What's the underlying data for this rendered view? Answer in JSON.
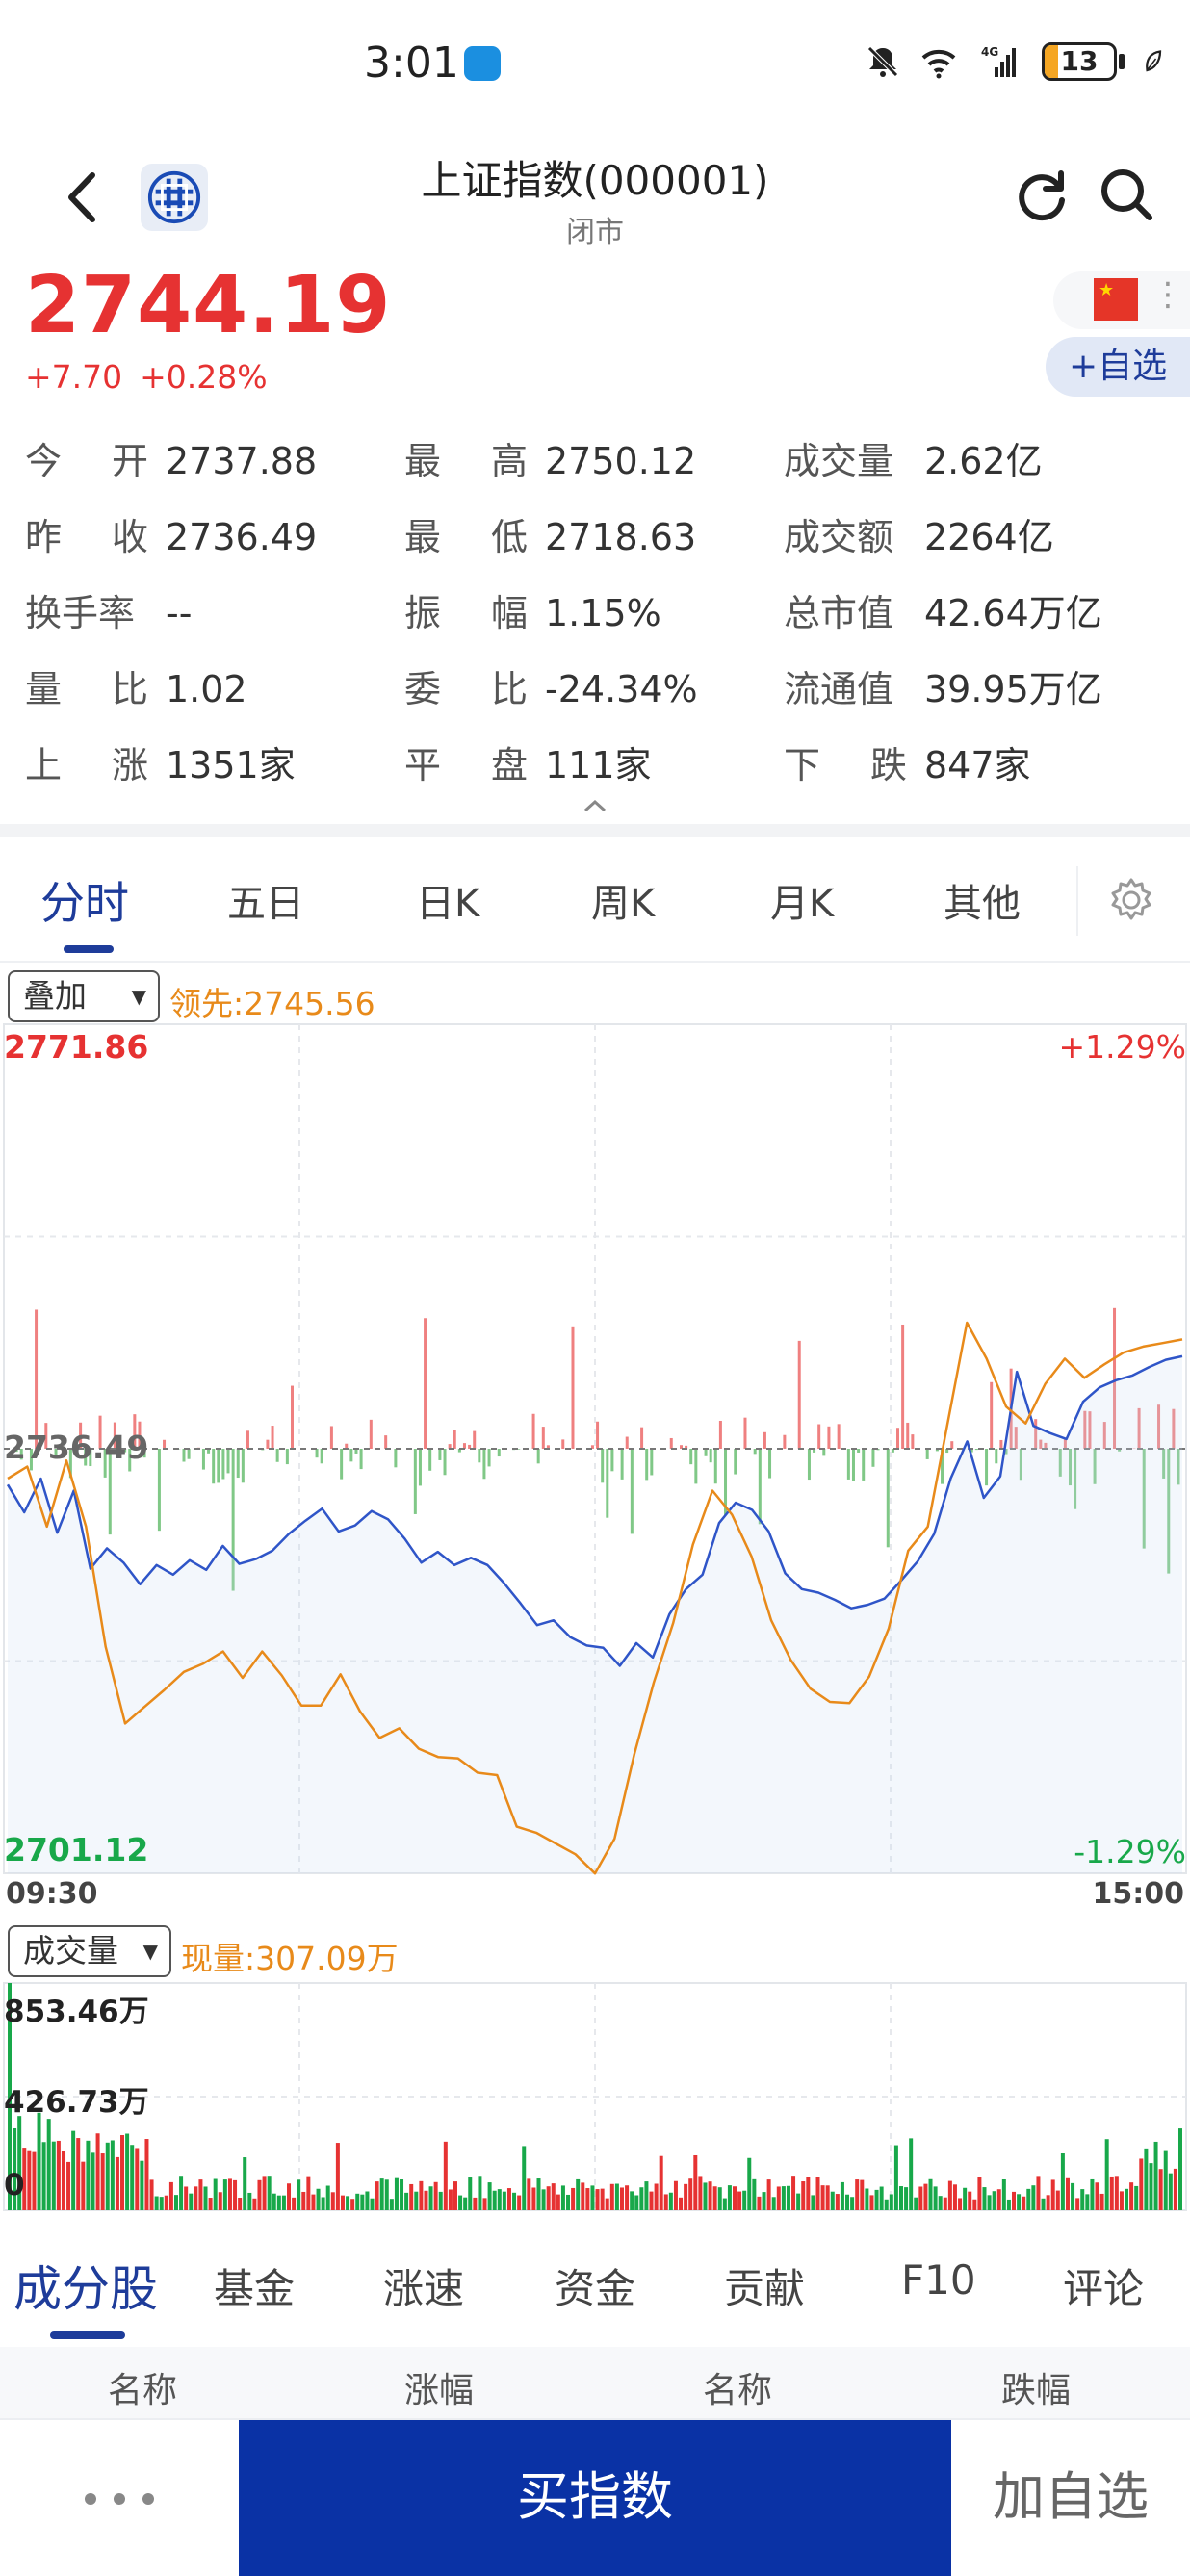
{
  "status_bar": {
    "time": "3:01",
    "battery": "13",
    "network_label": "4G",
    "wifi_label": "6"
  },
  "header": {
    "title": "上证指数(000001)",
    "subtitle": "闭市"
  },
  "quote": {
    "price": "2744.19",
    "change": "+7.70",
    "change_pct": "+0.28%",
    "watch_button": "+自选"
  },
  "stats": [
    [
      {
        "label": "今开",
        "value": "2737.88"
      },
      {
        "label": "最高",
        "value": "2750.12"
      },
      {
        "label": "成交量",
        "value": "2.62亿"
      }
    ],
    [
      {
        "label": "昨收",
        "value": "2736.49"
      },
      {
        "label": "最低",
        "value": "2718.63"
      },
      {
        "label": "成交额",
        "value": "2264亿"
      }
    ],
    [
      {
        "label": "换手率",
        "value": "--"
      },
      {
        "label": "振幅",
        "value": "1.15%"
      },
      {
        "label": "总市值",
        "value": "42.64万亿"
      }
    ],
    [
      {
        "label": "量比",
        "value": "1.02"
      },
      {
        "label": "委比",
        "value": "-24.34%"
      },
      {
        "label": "流通值",
        "value": "39.95万亿"
      }
    ],
    [
      {
        "label": "上涨",
        "value": "1351家"
      },
      {
        "label": "平盘",
        "value": "111家"
      },
      {
        "label": "下跌",
        "value": "847家"
      }
    ]
  ],
  "chart_tabs": [
    "分时",
    "五日",
    "日K",
    "周K",
    "月K",
    "其他"
  ],
  "overlay": {
    "dropdown": "叠加",
    "lead_label": "领先:2745.56"
  },
  "volume_panel": {
    "dropdown": "成交量",
    "now_label": "现量:307.09万"
  },
  "colors": {
    "up": "#e63232",
    "down": "#18a84a",
    "brand": "#1e3c9a",
    "index_line": "#2f55c8",
    "lead_line": "#e88a1a"
  },
  "chart_data": [
    {
      "type": "line",
      "title": "",
      "x_labels": [
        "09:30",
        "15:00"
      ],
      "ylim": [
        2701.12,
        2771.86
      ],
      "y_tick_labels": {
        "top": "2771.86",
        "mid": "2736.49",
        "bottom": "2701.12"
      },
      "pct_labels": {
        "top": "+1.29%",
        "bottom": "-1.29%"
      },
      "baseline": 2736.49,
      "grid": true,
      "series": [
        {
          "name": "",
          "color": "#2f55c8",
          "values": [
            2733.5,
            2731.2,
            2734.0,
            2729.5,
            2733.0,
            2726.5,
            2728.2,
            2727.0,
            2725.2,
            2726.8,
            2726.0,
            2727.2,
            2726.4,
            2728.4,
            2726.9,
            2727.3,
            2728.0,
            2729.4,
            2730.5,
            2731.5,
            2729.6,
            2730.1,
            2731.3,
            2730.6,
            2729.0,
            2727.0,
            2727.9,
            2726.8,
            2727.4,
            2726.8,
            2725.3,
            2723.6,
            2721.8,
            2722.2,
            2720.8,
            2720.1,
            2719.9,
            2718.4,
            2720.3,
            2719.1,
            2722.7,
            2724.8,
            2726.0,
            2730.3,
            2732.0,
            2731.4,
            2729.6,
            2726.1,
            2724.8,
            2724.5,
            2723.9,
            2723.2,
            2723.5,
            2724.0,
            2725.5,
            2727.1,
            2729.4,
            2734.0,
            2737.1,
            2732.4,
            2734.2,
            2742.9,
            2738.4,
            2737.8,
            2737.3,
            2740.4,
            2741.6,
            2742.2,
            2742.6,
            2743.3,
            2743.9,
            2744.2
          ],
          "note_not_rendered": ""
        },
        {
          "name": "",
          "color": "#e88a1a",
          "values": [
            2734.0,
            2735.0,
            2730.0,
            2735.5,
            2730.0,
            2720.0,
            2713.6,
            2715.0,
            2716.4,
            2717.9,
            2718.6,
            2719.6,
            2717.4,
            2719.6,
            2717.6,
            2715.1,
            2715.1,
            2717.7,
            2714.6,
            2712.4,
            2713.2,
            2711.5,
            2710.8,
            2710.7,
            2709.5,
            2709.3,
            2705.0,
            2704.5,
            2703.6,
            2702.7,
            2701.1,
            2704.0,
            2711.0,
            2717.0,
            2722.0,
            2728.5,
            2733.0,
            2731.0,
            2727.5,
            2722.2,
            2718.9,
            2716.5,
            2715.4,
            2715.3,
            2717.5,
            2721.5,
            2728.0,
            2730.0,
            2738.5,
            2747.0,
            2744.0,
            2740.0,
            2738.6,
            2741.9,
            2744.0,
            2742.4,
            2743.5,
            2744.5,
            2745.0,
            2745.3,
            2745.6
          ]
        }
      ]
    },
    {
      "type": "bar",
      "title": "",
      "x_labels": [
        "09:30",
        "15:00"
      ],
      "ylim": [
        0,
        853.46
      ],
      "y_tick_labels": [
        "853.46万",
        "426.73万",
        "0"
      ],
      "unit": "万",
      "last_value": 307.09
    }
  ]
}
